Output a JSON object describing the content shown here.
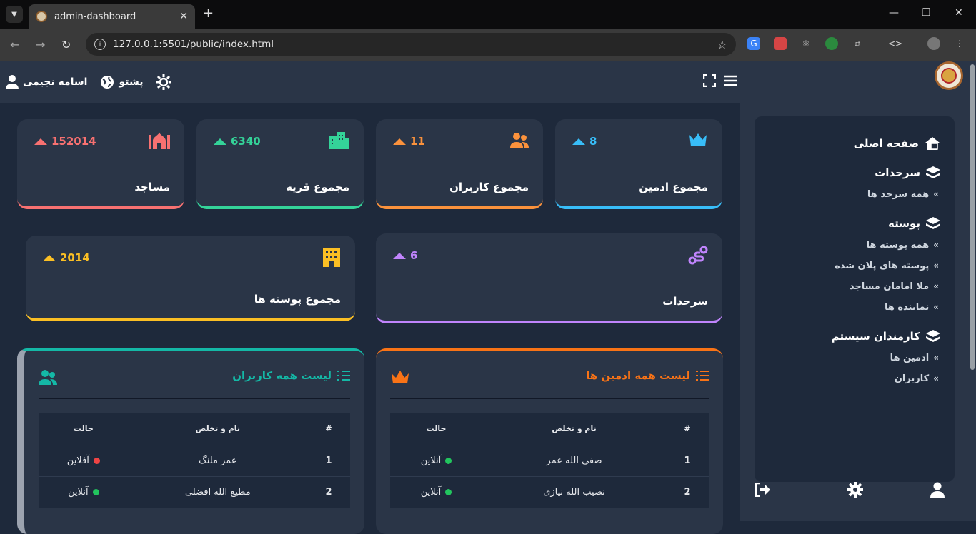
{
  "browser": {
    "tab_title": "admin-dashboard",
    "url": "127.0.0.1:5501/public/index.html"
  },
  "topbar": {
    "user_name": "اسامه نجیمی",
    "language": "پشتو"
  },
  "stats": [
    {
      "title": "مجموع ادمین",
      "value": "8",
      "color": "#38bdf8",
      "icon": "crown-icon"
    },
    {
      "title": "مجموع کاربران",
      "value": "11",
      "color": "#fb923c",
      "icon": "users-icon"
    },
    {
      "title": "مجموع قریه",
      "value": "6340",
      "color": "#34d399",
      "icon": "buildings-icon"
    },
    {
      "title": "مساجد",
      "value": "152014",
      "color": "#f87171",
      "icon": "mosque-icon"
    },
    {
      "title": "سرحدات",
      "value": "6",
      "color": "#c084fc",
      "icon": "route-icon"
    },
    {
      "title": "مجموع پوسته ها",
      "value": "2014",
      "color": "#fbbf24",
      "icon": "building-icon"
    }
  ],
  "sidebar": {
    "home": "صفحه اصلی",
    "sections": [
      {
        "label": "سرحدات",
        "items": [
          "همه سرحد ها"
        ]
      },
      {
        "label": "پوسته",
        "items": [
          "همه پوسته ها",
          "پوسته های پلان شده",
          "ملا امامان مساجد",
          "نماینده ها"
        ]
      },
      {
        "label": "کارمندان سیستم",
        "items": [
          "ادمین ها",
          "کاربران"
        ]
      }
    ]
  },
  "admins_table": {
    "title": "لیست همه ادمین ها",
    "color": "#f97316",
    "columns": [
      "#",
      "نام و تخلص",
      "حالت"
    ],
    "rows": [
      {
        "num": "1",
        "name": "صفی الله عمر",
        "status": "آنلاین",
        "status_color": "#22c55e"
      },
      {
        "num": "2",
        "name": "نصیب الله نیازی",
        "status": "آنلاین",
        "status_color": "#22c55e"
      }
    ]
  },
  "users_table": {
    "title": "لیست همه کاربران",
    "color": "#14b8a6",
    "columns": [
      "#",
      "نام و تخلص",
      "حالت"
    ],
    "rows": [
      {
        "num": "1",
        "name": "عمر ملنگ",
        "status": "آفلاین",
        "status_color": "#ef4444"
      },
      {
        "num": "2",
        "name": "مطیع الله افضلی",
        "status": "آنلاین",
        "status_color": "#22c55e"
      }
    ]
  }
}
